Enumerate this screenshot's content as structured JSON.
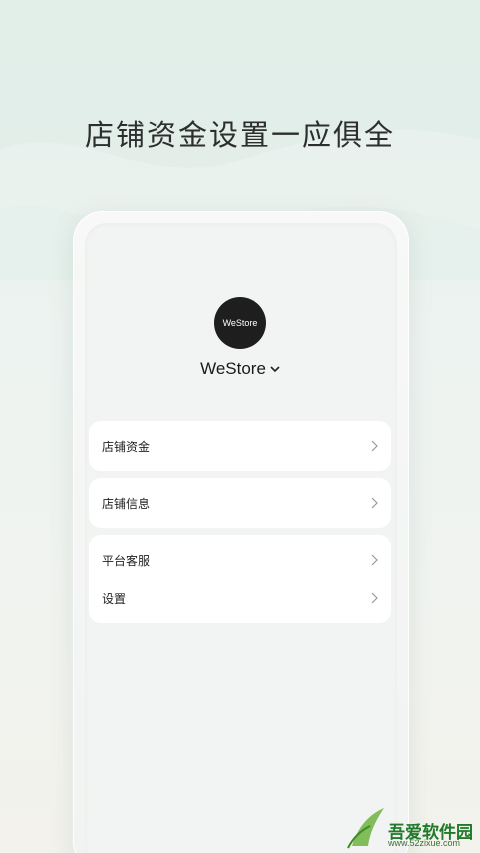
{
  "promo": {
    "headline": "店铺资金设置一应俱全"
  },
  "store": {
    "logo_text": "WeStore",
    "name": "WeStore"
  },
  "menu": {
    "group1": [
      {
        "label": "店铺资金"
      }
    ],
    "group2": [
      {
        "label": "店铺信息"
      }
    ],
    "group3": [
      {
        "label": "平台客服"
      },
      {
        "label": "设置"
      }
    ]
  },
  "watermark": {
    "brand": "吾爱软件园",
    "url": "www.52zixue.com"
  },
  "colors": {
    "accent": "#1f7a2a",
    "background": "#e6f0ec"
  }
}
